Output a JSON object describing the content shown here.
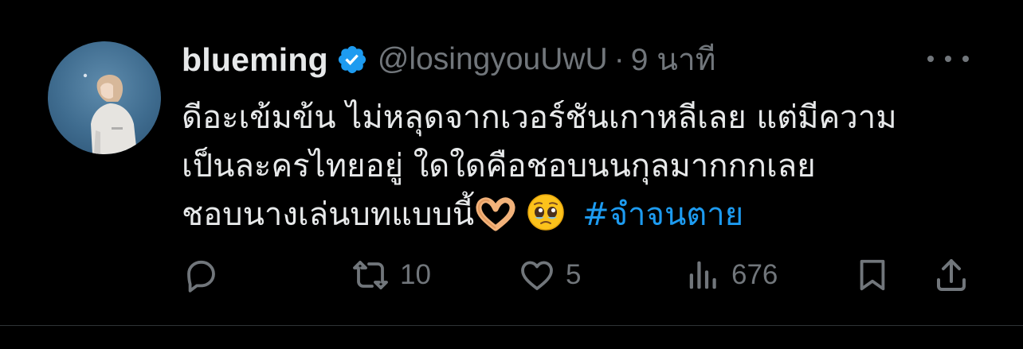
{
  "tweet": {
    "display_name": "blueming",
    "handle": "@losingyouUwU",
    "separator": "·",
    "time": "9 นาที",
    "verified": true,
    "text_lines": [
      "ดีอะเข้มข้น ไม่หลุดจากเวอร์ชันเกาหลีเลย แต่มีความ",
      "เป็นละครไทยอยู่ ใดใดคือชอบนนกุลมากกกเลย",
      "ชอบนางเล่นบทแบบนี้"
    ],
    "emojis": [
      "heart-hands-emoji",
      "pleading-face-emoji"
    ],
    "hashtag": "#จำจนตาย"
  },
  "actions": {
    "reply": {
      "icon": "reply-icon",
      "count": ""
    },
    "retweet": {
      "icon": "retweet-icon",
      "count": "10"
    },
    "like": {
      "icon": "heart-icon",
      "count": "5"
    },
    "views": {
      "icon": "views-icon",
      "count": "676"
    },
    "bookmark": {
      "icon": "bookmark-icon"
    },
    "share": {
      "icon": "share-icon"
    }
  },
  "colors": {
    "background": "#000000",
    "text": "#e7e9ea",
    "secondary": "#71767b",
    "accent": "#1d9bf0"
  }
}
